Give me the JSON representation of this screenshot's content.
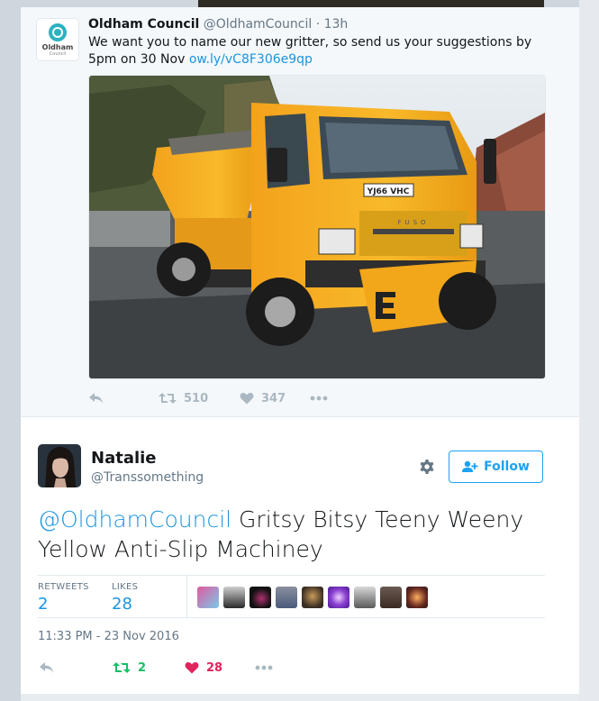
{
  "parent_tweet": {
    "author_name": "Oldham Council",
    "author_handle": "@OldhamCouncil",
    "separator": "·",
    "time": "13h",
    "text": "We want you to name our new gritter, so send us your suggestions by 5pm on 30 Nov ",
    "link": "ow.ly/vC8F306e9qp",
    "avatar_logo": {
      "word": "Oldham",
      "sub": "Council"
    },
    "photo_plate": "YJ66 VHC",
    "photo_blade_letter": "E",
    "photo_cab_logo": "FUSO",
    "actions": {
      "retweets": "510",
      "likes": "347"
    }
  },
  "tweet": {
    "author_name": "Natalie",
    "author_handle": "@Transsomething",
    "follow_label": "Follow",
    "mention": "@OldhamCouncil",
    "text": " Gritsy Bitsy Teeny Weeny Yellow Anti-Slip Machiney",
    "stats": {
      "retweets_label": "RETWEETS",
      "retweets_value": "2",
      "likes_label": "LIKES",
      "likes_value": "28"
    },
    "timestamp": "11:33 PM - 23 Nov 2016",
    "actions": {
      "retweets": "2",
      "likes": "28"
    }
  },
  "colors": {
    "accent": "#1da1f2",
    "link": "#1b95e0",
    "retweet_active": "#17bf63",
    "like_active": "#e0245e",
    "muted": "#aab8c2"
  },
  "icons": [
    "reply-icon",
    "retweet-icon",
    "heart-icon",
    "more-icon",
    "gear-icon",
    "follow-person-icon"
  ]
}
